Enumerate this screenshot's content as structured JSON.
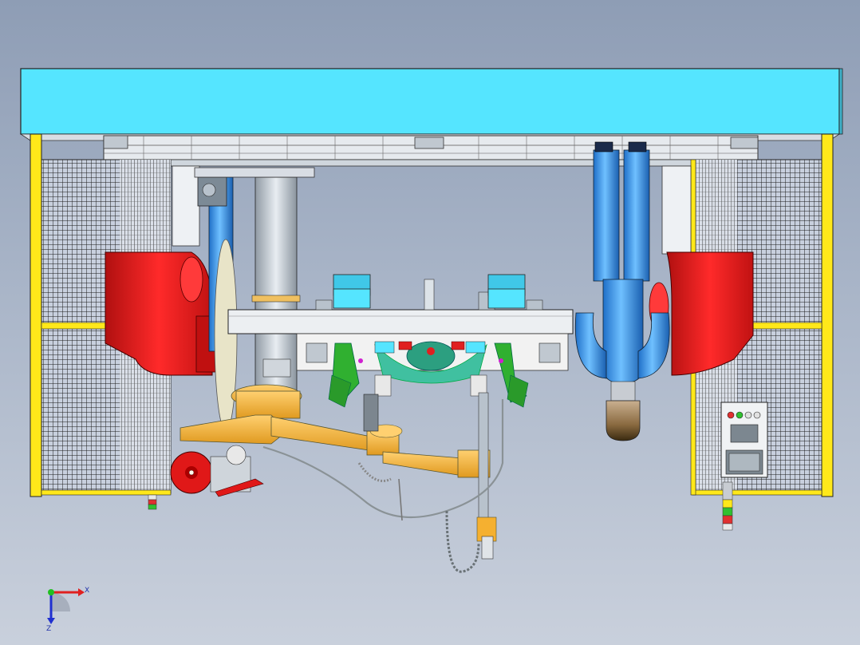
{
  "axes": {
    "x_label": "X",
    "z_label": "Z",
    "x_color": "#e02020",
    "y_color": "#20c020",
    "z_color": "#2030d0"
  },
  "colors": {
    "beam": "#55e5ff",
    "frame_yellow": "#ffe81a",
    "robot_red": "#e01818",
    "robot_blue": "#3a8fe0",
    "arm_orange": "#f5b030",
    "gripper_green": "#30b030",
    "mesh": "#202020"
  },
  "panel": {
    "light_colors": [
      "#e03030",
      "#30c030",
      "#e0e0e0",
      "#e0e0e0"
    ]
  }
}
